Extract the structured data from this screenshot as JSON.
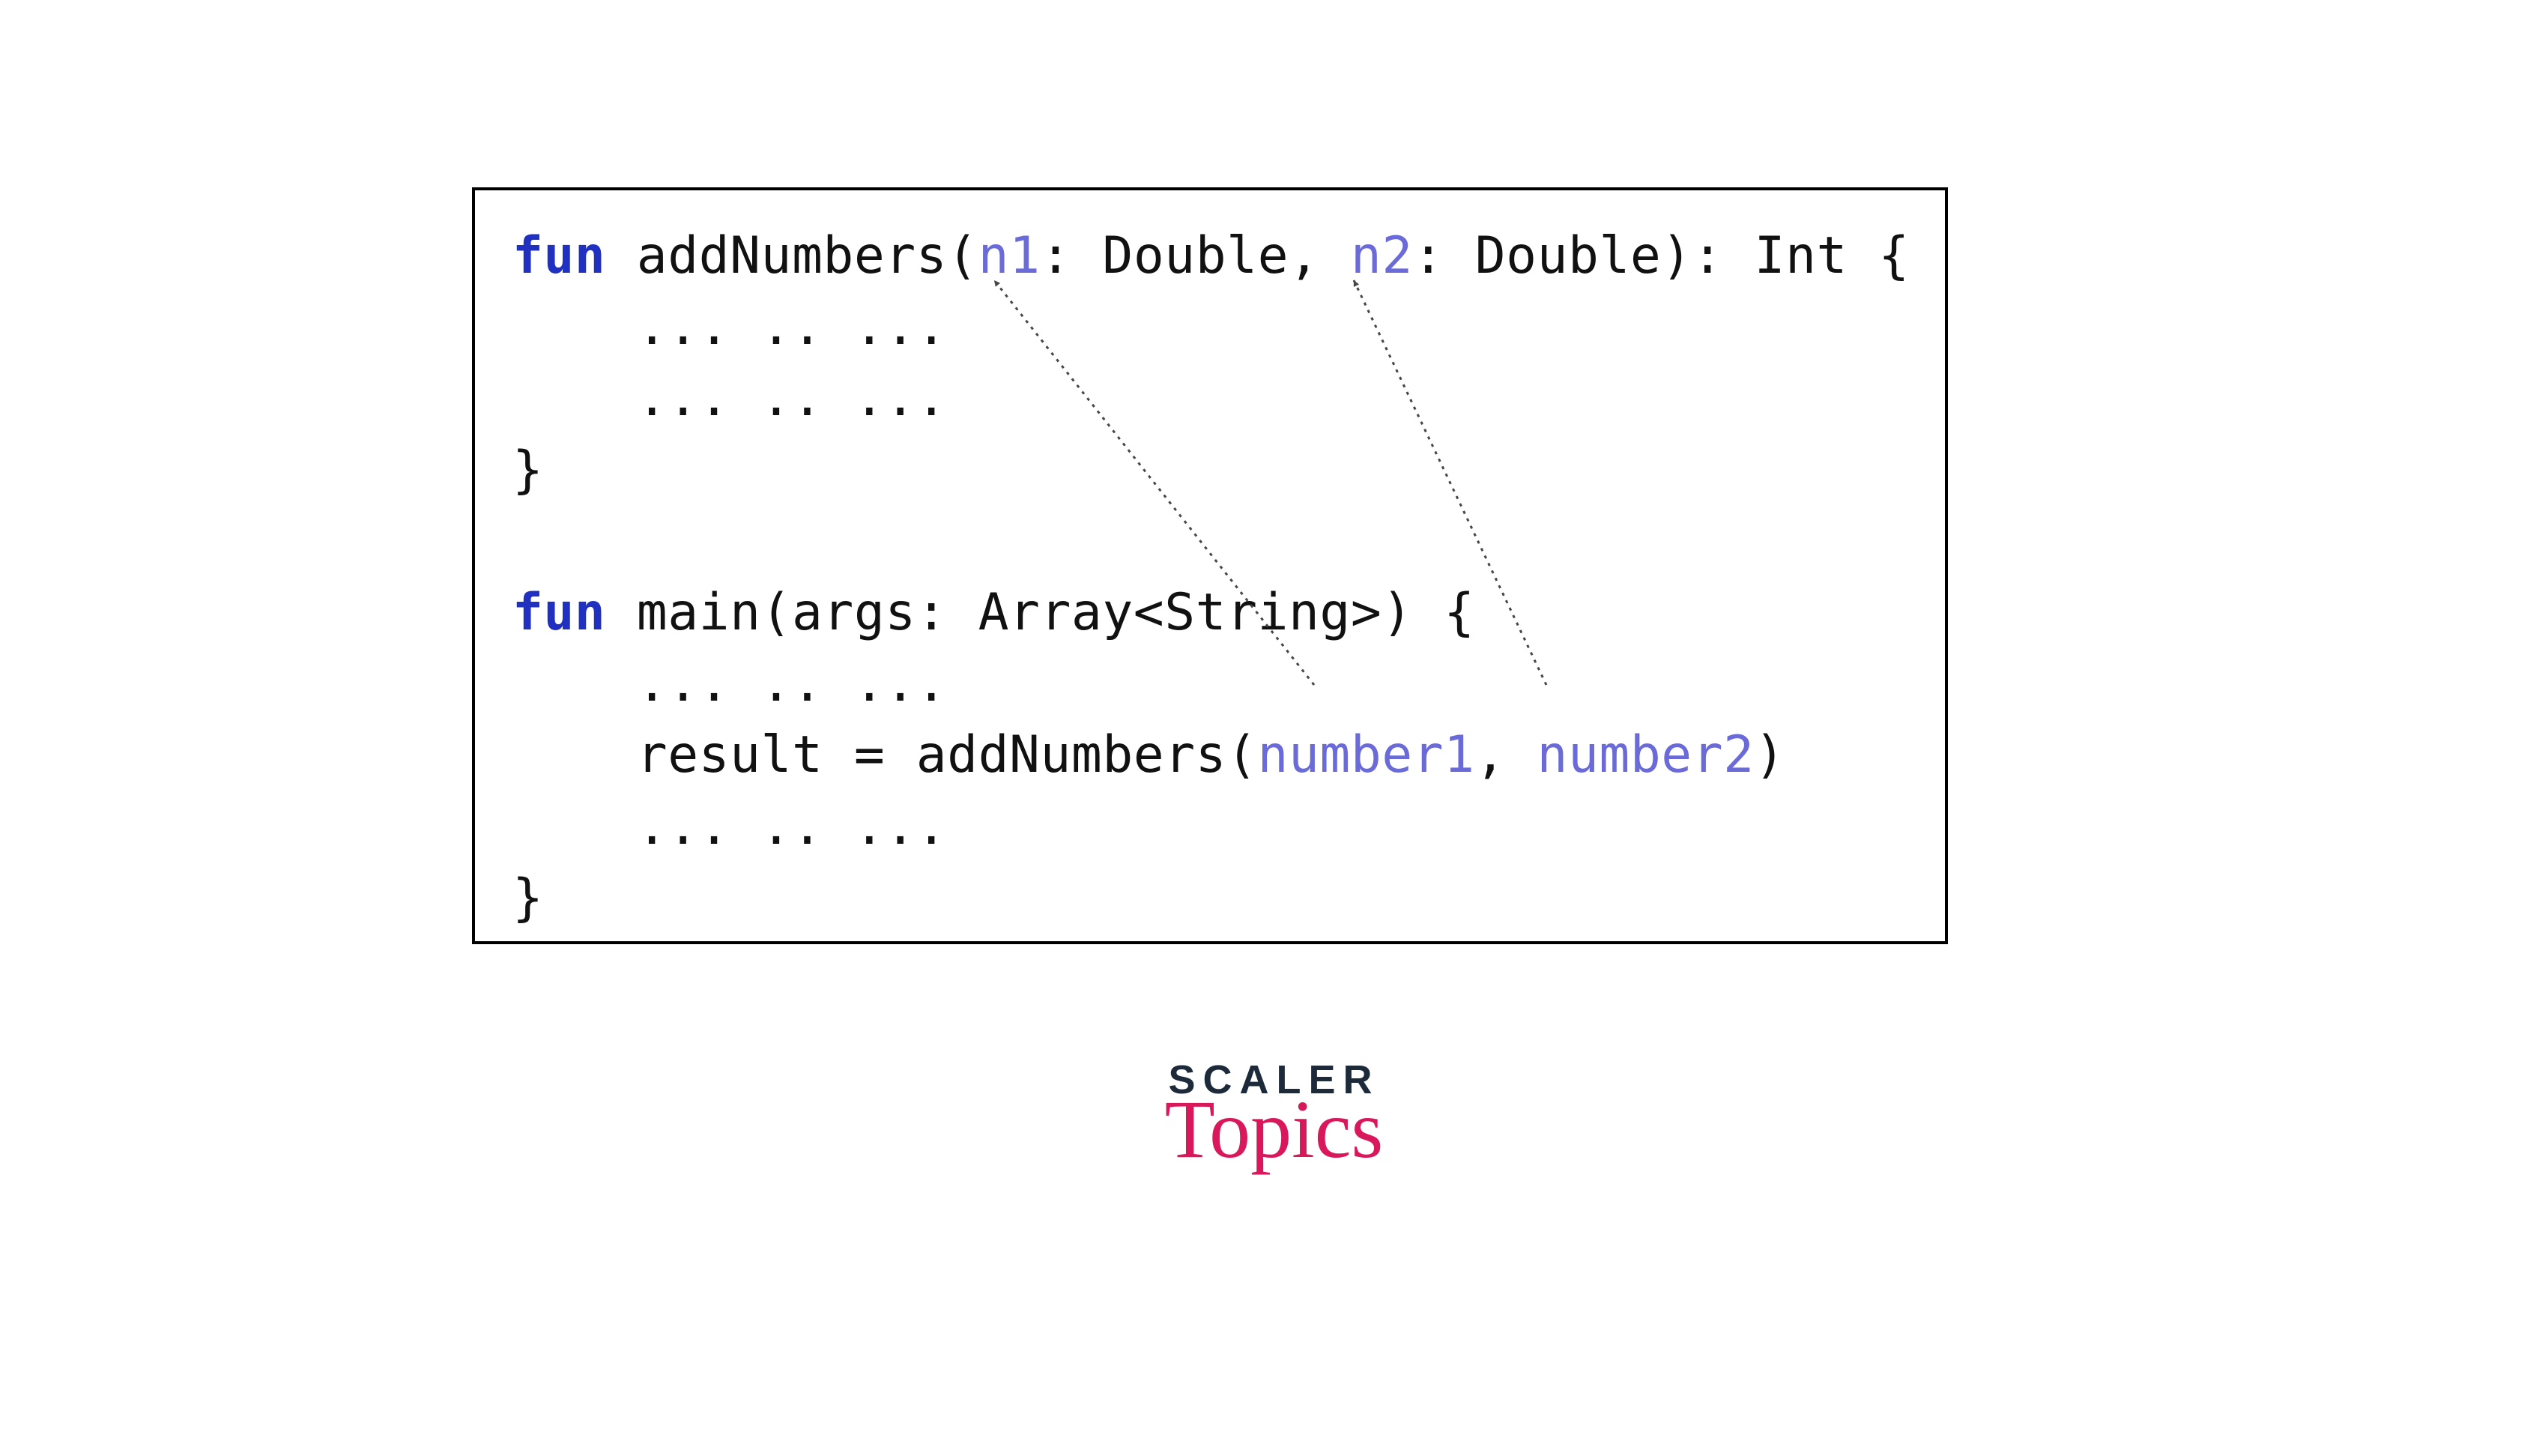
{
  "code": {
    "line1": {
      "kw": "fun",
      "sp1": " ",
      "name_open": "addNumbers(",
      "p1": "n1",
      "after_p1": ": Double, ",
      "p2": "n2",
      "after_p2": ": Double): Int {"
    },
    "line2": "    ... .. ...",
    "line3": "    ... .. ...",
    "line4": "}",
    "blank": "",
    "line6": {
      "kw": "fun",
      "rest": " main(args: Array<String>) {"
    },
    "line7": "    ... .. ...",
    "line8": {
      "lead": "    result = addNumbers(",
      "a1": "number1",
      "comma": ", ",
      "a2": "number2",
      "close": ")"
    },
    "line9": "    ... .. ...",
    "line10": "}"
  },
  "logo": {
    "line1": "SCALER",
    "line2": "Topics"
  }
}
